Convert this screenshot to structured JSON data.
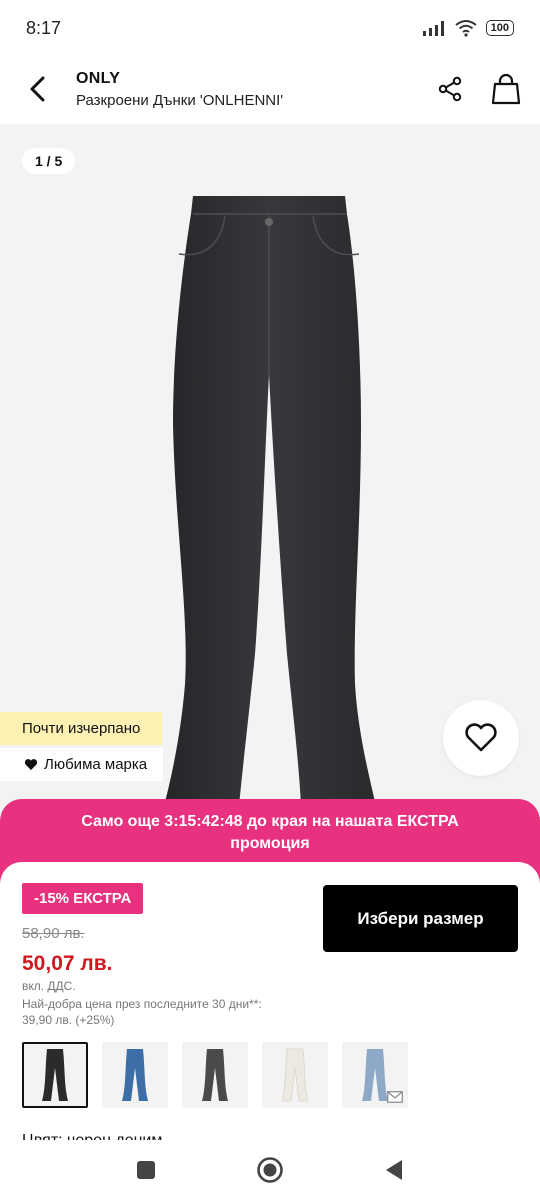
{
  "status": {
    "time": "8:17",
    "battery": "100"
  },
  "header": {
    "brand": "ONLY",
    "product_name": "Разкроени Дънки 'ONLHENNI'"
  },
  "gallery": {
    "counter": "1 / 5",
    "badge_low_stock": "Почти изчерпано",
    "badge_favorite": "Любима марка"
  },
  "promo": {
    "line1": "Само още 3:15:42:48 до края на нашата ЕКСТРА",
    "line2": "промоция"
  },
  "pricing": {
    "discount": "-15% ЕКСТРА",
    "old_price": "58,90 лв.",
    "new_price": "50,07 лв.",
    "vat": "вкл. ДДС.",
    "best_price_line1": "Най-добра цена през последните 30 дни**:",
    "best_price_line2": "39,90 лв. (+25%)"
  },
  "actions": {
    "select_size": "Избери размер"
  },
  "variants": [
    {
      "name": "black",
      "color": "#2b2b2b"
    },
    {
      "name": "blue",
      "color": "#3d6ea8"
    },
    {
      "name": "dark-grey",
      "color": "#4a4a4a"
    },
    {
      "name": "white",
      "color": "#ece9e1"
    },
    {
      "name": "light-blue",
      "color": "#8ea9c8"
    }
  ],
  "color_label": "Цвят: черен деним",
  "colors": {
    "accent": "#e8317f",
    "price_red": "#d0191f",
    "low_stock_bg": "#fdf0b3",
    "button_black": "#000000"
  },
  "icons": {
    "back": "chevron-left-icon",
    "share": "share-icon",
    "bag": "shopping-bag-icon",
    "heart": "heart-icon",
    "mail": "mail-icon"
  }
}
